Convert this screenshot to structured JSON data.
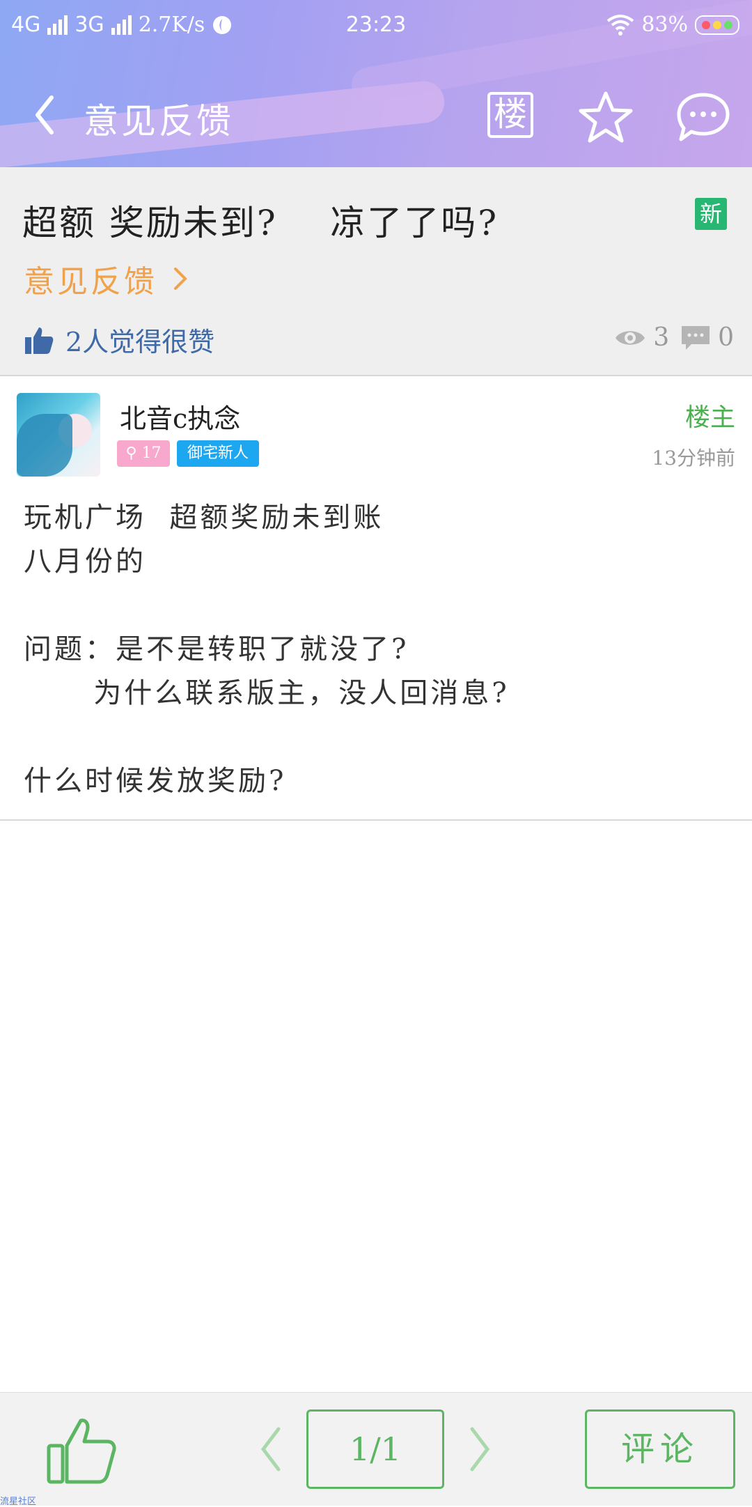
{
  "status_bar": {
    "network1": "4G",
    "network2": "3G",
    "speed": "2.7K/s",
    "time": "23:23",
    "battery": "83%"
  },
  "nav": {
    "title": "意见反馈",
    "floor_icon_char": "楼"
  },
  "thread": {
    "title": "超额 奖励未到?    凉了了吗?",
    "new_badge": "新",
    "forum": "意见反馈",
    "likes_text": "2人觉得很赞",
    "views": "3",
    "comments": "0"
  },
  "post": {
    "username": "北音c执念",
    "level": "17",
    "user_title": "御宅新人",
    "op_label": "楼主",
    "time": "13分钟前",
    "lines": [
      "玩机广场  超额奖励未到账",
      "八月份的",
      "",
      "问题：是不是转职了就没了?",
      "      为什么联系版主，没人回消息?",
      "",
      "什么时候发放奖励?"
    ]
  },
  "bottom": {
    "pager": "1/1",
    "comment_label": "评论"
  },
  "watermark": "流星社区",
  "colors": {
    "accent_green": "#5cb563",
    "forum_orange": "#f0a14a",
    "likes_blue": "#3f6aa7",
    "new_badge_green": "#27b773"
  }
}
